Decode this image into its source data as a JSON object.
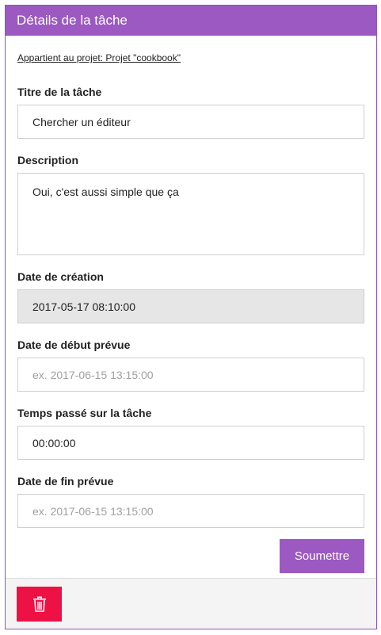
{
  "header": {
    "title": "Détails de la tâche"
  },
  "project_link": "Appartient au projet: Projet \"cookbook\"",
  "fields": {
    "title": {
      "label": "Titre de la tâche",
      "value": "Chercher un éditeur"
    },
    "description": {
      "label": "Description",
      "value": "Oui, c'est aussi simple que ça"
    },
    "created": {
      "label": "Date de création",
      "value": "2017-05-17 08:10:00"
    },
    "planned_start": {
      "label": "Date de début prévue",
      "value": "",
      "placeholder": "ex. 2017-06-15 13:15:00"
    },
    "time_spent": {
      "label": "Temps passé sur la tâche",
      "value": "00:00:00"
    },
    "planned_end": {
      "label": "Date de fin prévue",
      "value": "",
      "placeholder": "ex. 2017-06-15 13:15:00"
    }
  },
  "submit_label": "Soumettre",
  "footer": {
    "delete_icon": "trash-icon"
  },
  "colors": {
    "accent": "#9b59c1",
    "danger": "#ee1144",
    "readonly_bg": "#e6e6e6"
  }
}
